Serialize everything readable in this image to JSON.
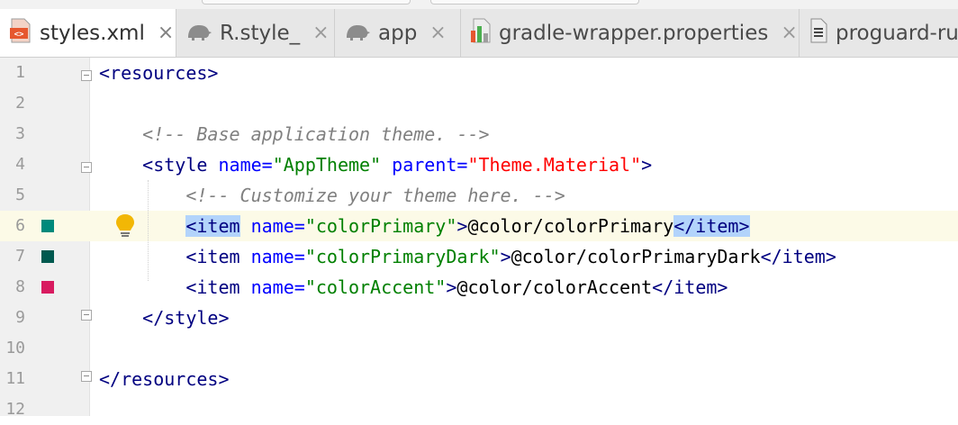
{
  "tabs": [
    {
      "label": "styles.xml",
      "icon": "xml-file-icon",
      "active": true
    },
    {
      "label": "R.style_",
      "icon": "android-class-icon",
      "active": false
    },
    {
      "label": "app",
      "icon": "android-module-icon",
      "active": false
    },
    {
      "label": "gradle-wrapper.properties",
      "icon": "properties-file-icon",
      "active": false
    },
    {
      "label": "proguard-ru",
      "icon": "text-file-icon",
      "active": false
    }
  ],
  "tab_close_glyph": "×",
  "colors": {
    "colorPrimary": "#00897b",
    "colorPrimaryDark": "#00594f",
    "colorAccent": "#d81b60",
    "tag": "#000080",
    "attribute": "#0000ff",
    "string": "#008000",
    "comment": "#808080",
    "current_line": "#fcfae7",
    "match_highlight": "#b3d4fb"
  },
  "gutter_icons": [
    "fold-marker-icon",
    "lightbulb-icon"
  ],
  "lines": [
    {
      "number": "1",
      "tokens": [
        {
          "t": "<",
          "c": "tag"
        },
        {
          "t": "resources",
          "c": "tag"
        },
        {
          "t": ">",
          "c": "tag"
        }
      ]
    },
    {
      "number": "2",
      "tokens": []
    },
    {
      "number": "3",
      "tokens": [
        {
          "t": "    "
        },
        {
          "t": "<!-- Base application theme. -->",
          "c": "cmt"
        }
      ]
    },
    {
      "number": "4",
      "tokens": [
        {
          "t": "    "
        },
        {
          "t": "<",
          "c": "tag"
        },
        {
          "t": "style",
          "c": "tag"
        },
        {
          "t": " "
        },
        {
          "t": "name",
          "c": "attr"
        },
        {
          "t": "=",
          "c": "attr"
        },
        {
          "t": "\"AppTheme\"",
          "c": "str"
        },
        {
          "t": " "
        },
        {
          "t": "parent",
          "c": "attr"
        },
        {
          "t": "=",
          "c": "attr"
        },
        {
          "t": "\"",
          "c": "strred"
        },
        {
          "t": "Theme.Material",
          "c": "strred"
        },
        {
          "t": "\"",
          "c": "strred"
        },
        {
          "t": ">",
          "c": "tag"
        }
      ]
    },
    {
      "number": "5",
      "tokens": [
        {
          "t": "        "
        },
        {
          "t": "<!-- Customize your theme here. -->",
          "c": "cmt"
        }
      ]
    },
    {
      "number": "6",
      "tokens": [
        {
          "t": "        "
        },
        {
          "t": "<item",
          "c": "tag",
          "hl": true
        },
        {
          "t": " "
        },
        {
          "t": "name",
          "c": "attr"
        },
        {
          "t": "=",
          "c": "attr"
        },
        {
          "t": "\"colorPrimary\"",
          "c": "str"
        },
        {
          "t": ">",
          "c": "tag"
        },
        {
          "t": "@color/colorPrimary"
        },
        {
          "t": "</item",
          "c": "tag",
          "hl": true
        },
        {
          "t": ">",
          "c": "tag",
          "hl": true
        }
      ]
    },
    {
      "number": "7",
      "tokens": [
        {
          "t": "        "
        },
        {
          "t": "<item",
          "c": "tag"
        },
        {
          "t": " "
        },
        {
          "t": "name",
          "c": "attr"
        },
        {
          "t": "=",
          "c": "attr"
        },
        {
          "t": "\"colorPrimaryDark\"",
          "c": "str"
        },
        {
          "t": ">",
          "c": "tag"
        },
        {
          "t": "@color/colorPrimaryDark"
        },
        {
          "t": "</item",
          "c": "tag"
        },
        {
          "t": ">",
          "c": "tag"
        }
      ]
    },
    {
      "number": "8",
      "tokens": [
        {
          "t": "        "
        },
        {
          "t": "<item",
          "c": "tag"
        },
        {
          "t": " "
        },
        {
          "t": "name",
          "c": "attr"
        },
        {
          "t": "=",
          "c": "attr"
        },
        {
          "t": "\"colorAccent\"",
          "c": "str"
        },
        {
          "t": ">",
          "c": "tag"
        },
        {
          "t": "@color/colorAccent"
        },
        {
          "t": "</item",
          "c": "tag"
        },
        {
          "t": ">",
          "c": "tag"
        }
      ]
    },
    {
      "number": "9",
      "tokens": [
        {
          "t": "    "
        },
        {
          "t": "</style",
          "c": "tag"
        },
        {
          "t": ">",
          "c": "tag"
        }
      ]
    },
    {
      "number": "10",
      "tokens": []
    },
    {
      "number": "11",
      "tokens": [
        {
          "t": "</resources",
          "c": "tag"
        },
        {
          "t": ">",
          "c": "tag"
        }
      ]
    },
    {
      "number": "12",
      "tokens": []
    }
  ]
}
